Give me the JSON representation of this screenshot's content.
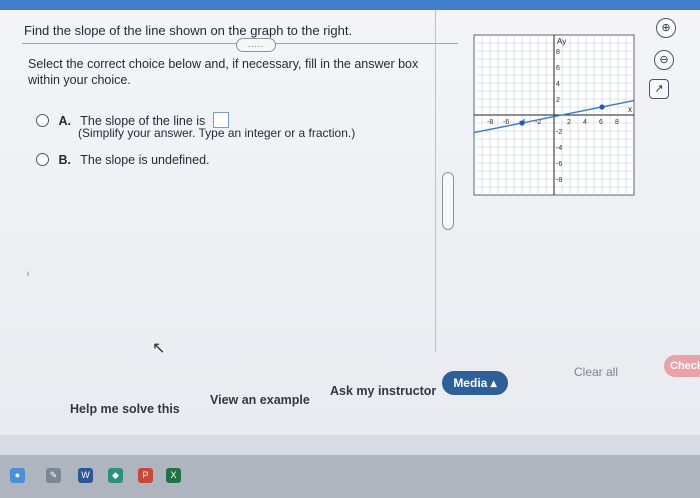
{
  "question": {
    "title": "Find the slope of the line shown on the graph to the right.",
    "more_button": "....."
  },
  "instructions": "Select the correct choice below and, if necessary, fill in the answer box within your choice.",
  "choices": [
    {
      "letter": "A.",
      "text": "The slope of the line is",
      "hint": "(Simplify your answer. Type an integer or a fraction.)"
    },
    {
      "letter": "B.",
      "text": "The slope is undefined."
    }
  ],
  "graph": {
    "axis_y_label": "Ay",
    "axis_x_label": "x",
    "y_ticks": [
      "8",
      "6",
      "4",
      "2",
      "-2",
      "-4",
      "-6",
      "-8"
    ],
    "x_ticks": [
      "-8",
      "-6",
      "-4",
      "-2",
      "2",
      "4",
      "6",
      "8"
    ],
    "line_points": [
      [
        -4,
        -1
      ],
      [
        6,
        1
      ]
    ]
  },
  "graph_tools": [
    {
      "icon": "zoom-in-icon",
      "glyph": "⊕"
    },
    {
      "icon": "zoom-out-icon",
      "glyph": "⊖"
    },
    {
      "icon": "external-link-icon",
      "glyph": "↗"
    }
  ],
  "bottom_bar": {
    "help": "Help me solve this",
    "example": "View an example",
    "instructor": "Ask my instructor",
    "media": "Media ▴",
    "clear_all": "Clear all",
    "check": "Check"
  },
  "taskbar_icons": [
    {
      "name": "chrome-icon",
      "glyph": "●",
      "color": "#4a90d9"
    },
    {
      "name": "finder-icon",
      "glyph": "✎",
      "color": "#7a8794"
    },
    {
      "name": "word-icon",
      "glyph": "W",
      "color": "#2b5797"
    },
    {
      "name": "app-icon",
      "glyph": "◆",
      "color": "#2f8f7f"
    },
    {
      "name": "powerpoint-icon",
      "glyph": "P",
      "color": "#c64a3a"
    },
    {
      "name": "excel-icon",
      "glyph": "X",
      "color": "#217346"
    }
  ],
  "colors": {
    "accent": "#2d5f98",
    "line": "#3a78c2",
    "point": "#1f57c9"
  }
}
